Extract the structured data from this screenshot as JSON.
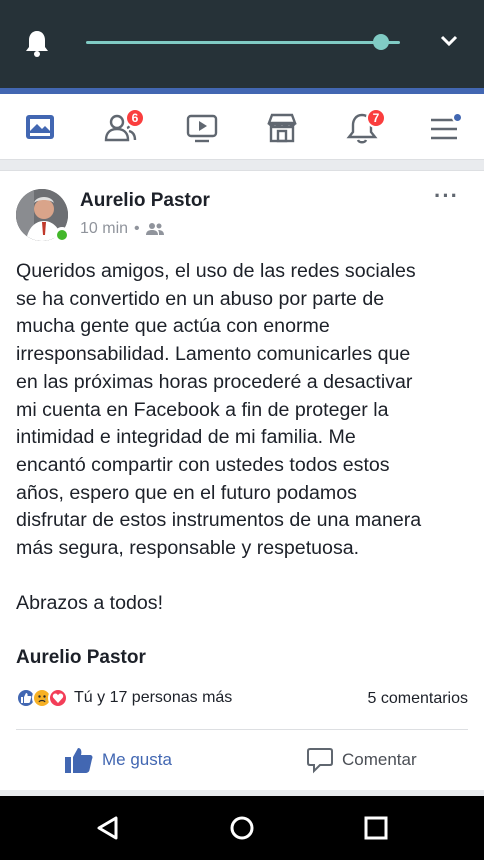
{
  "status_bar": {
    "brightness_level": 0.94,
    "accent_color": "#80cbc4",
    "icons": [
      "bell-icon",
      "chevron-down-icon"
    ]
  },
  "nav": {
    "brand_color": "#4267b2",
    "friend_requests_badge": "6",
    "notifications_badge": "7",
    "icons": [
      "news-feed-icon",
      "friends-icon",
      "watch-icon",
      "marketplace-icon",
      "notifications-icon",
      "menu-icon"
    ]
  },
  "post": {
    "author": "Aurelio Pastor",
    "time": "10 min",
    "separator": "•",
    "more_label": "···",
    "body": "Queridos amigos, el uso de las redes sociales\nse ha convertido en un abuso por parte de\nmucha gente que actúa con enorme\nirresponsabilidad. Lamento comunicarles que\nen las próximas horas procederé a desactivar\nmi cuenta en Facebook a fin de proteger la\nintimidad e integridad de mi familia. Me\nencantó compartir con ustedes todos estos\naños, espero que en el futuro podamos\ndisfrutar de estos instrumentos de una manera\nmás segura, responsable y respetuosa.\n\nAbrazos a todos!",
    "signature": "Aurelio Pastor",
    "reactions_text": "Tú y 17 personas más",
    "comments_count": "5 comentarios",
    "like_label": "Me gusta",
    "comment_label": "Comentar"
  },
  "android_nav": {
    "icons": [
      "back-icon",
      "home-icon",
      "recents-icon"
    ]
  }
}
